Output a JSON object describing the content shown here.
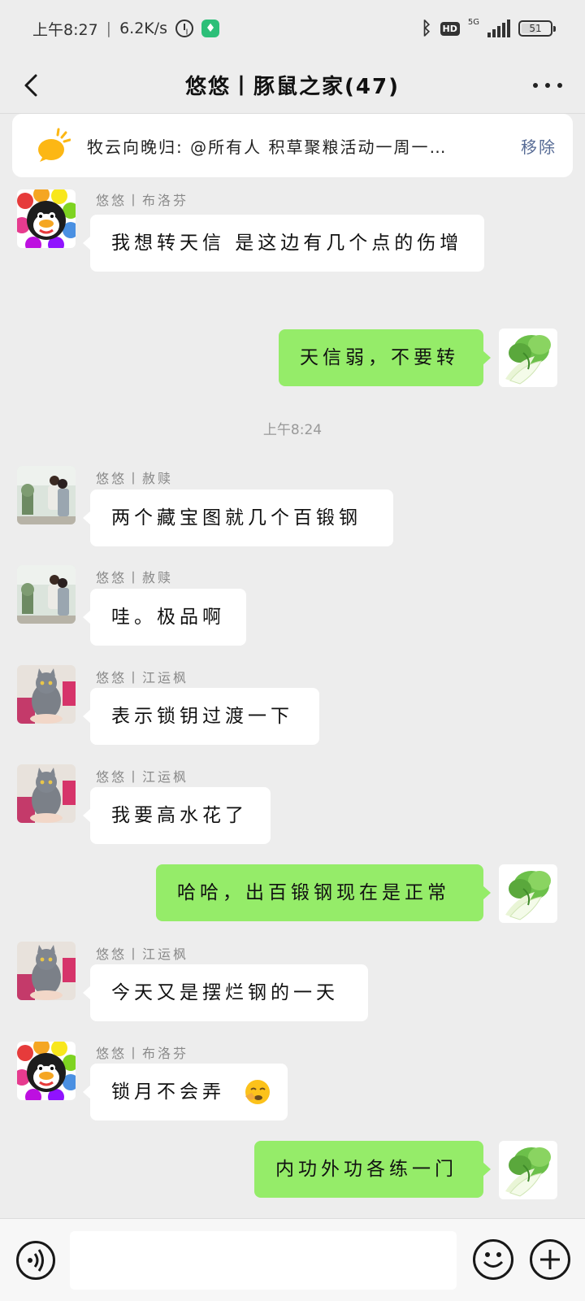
{
  "status_bar": {
    "time": "上午8:27",
    "separator": "|",
    "net_speed": "6.2K/s",
    "app_badge": "♦",
    "hd_label": "HD",
    "network_label": "5G",
    "battery": "51"
  },
  "header": {
    "title": "悠悠丨豚鼠之家(47)"
  },
  "notice": {
    "text": "牧云向晚归: @所有人 积草聚粮活动一周一…",
    "remove_label": "移除"
  },
  "messages": [
    {
      "side": "left",
      "sender": "悠悠丨布洛芬",
      "avatar": "penguin-flower-avatar",
      "text": "我想转天信 是这边有几个点的伤增"
    },
    {
      "side": "right",
      "avatar": "cabbage-avatar",
      "text": "天信弱，不要转"
    },
    {
      "side": "left",
      "sender": "悠悠丨赦赎",
      "avatar": "wedding-photo-avatar",
      "text": "两个藏宝图就几个百锻钢"
    },
    {
      "side": "left",
      "sender": "悠悠丨赦赎",
      "avatar": "wedding-photo-avatar",
      "text": "哇。极品啊"
    },
    {
      "side": "left",
      "sender": "悠悠丨江运枫",
      "avatar": "gray-cat-avatar",
      "text": "表示锁钥过渡一下"
    },
    {
      "side": "left",
      "sender": "悠悠丨江运枫",
      "avatar": "gray-cat-avatar",
      "text": "我要高水花了"
    },
    {
      "side": "right",
      "avatar": "cabbage-avatar",
      "text": "哈哈，出百锻钢现在是正常"
    },
    {
      "side": "left",
      "sender": "悠悠丨江运枫",
      "avatar": "gray-cat-avatar",
      "text": "今天又是摆烂钢的一天"
    },
    {
      "side": "left",
      "sender": "悠悠丨布洛芬",
      "avatar": "penguin-flower-avatar",
      "text": "锁月不会弄"
    },
    {
      "side": "right",
      "avatar": "cabbage-avatar",
      "text": "内功外功各练一门"
    }
  ],
  "timestamp": "上午8:24",
  "input": {
    "value": "",
    "placeholder": ""
  },
  "colors": {
    "my_bubble": "#95ec69",
    "their_bubble": "#ffffff",
    "background": "#ededed",
    "link": "#576b95"
  }
}
